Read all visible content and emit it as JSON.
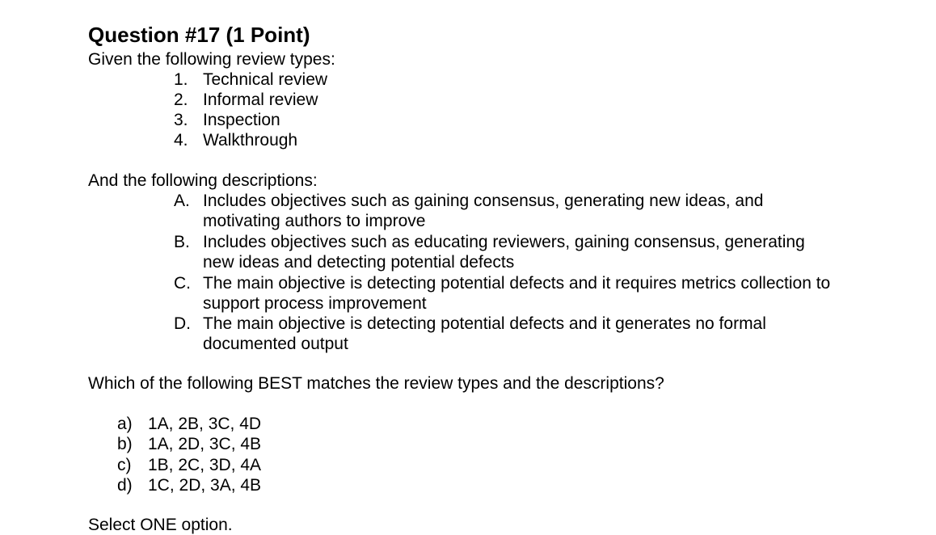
{
  "question": {
    "title": "Question #17 (1 Point)",
    "intro": "Given the following review types:"
  },
  "review_types": [
    {
      "marker": "1.",
      "text": "Technical review"
    },
    {
      "marker": "2.",
      "text": "Informal review"
    },
    {
      "marker": "3.",
      "text": "Inspection"
    },
    {
      "marker": "4.",
      "text": "Walkthrough"
    }
  ],
  "descriptions_intro": "And the following descriptions:",
  "descriptions": [
    {
      "marker": "A.",
      "line1": "Includes objectives such as gaining consensus, generating new ideas, and",
      "line2": "motivating authors to improve"
    },
    {
      "marker": "B.",
      "line1": "Includes objectives such as educating reviewers, gaining consensus, generating",
      "line2": "new ideas and detecting potential defects"
    },
    {
      "marker": "C.",
      "line1": "The main objective is detecting potential defects and it requires metrics collection to",
      "line2": "support process improvement"
    },
    {
      "marker": "D.",
      "line1": "The main objective is detecting potential defects and it generates no formal",
      "line2": "documented output"
    }
  ],
  "prompt": "Which of the following BEST matches the review types and the descriptions?",
  "options": [
    {
      "marker": "a)",
      "text": "1A, 2B, 3C, 4D"
    },
    {
      "marker": "b)",
      "text": "1A, 2D, 3C, 4B"
    },
    {
      "marker": "c)",
      "text": "1B, 2C, 3D, 4A"
    },
    {
      "marker": "d)",
      "text": "1C, 2D, 3A, 4B"
    }
  ],
  "instruction": "Select ONE option."
}
